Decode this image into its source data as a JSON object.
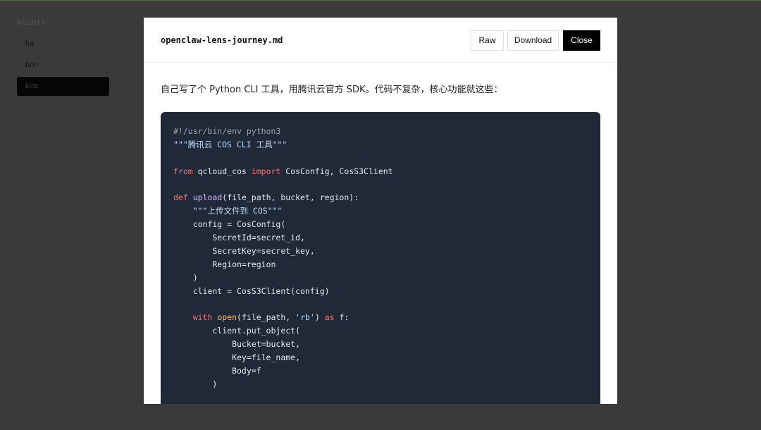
{
  "sidebar": {
    "heading": "AGENTS",
    "items": [
      {
        "label": "ha",
        "active": false
      },
      {
        "label": "hon",
        "active": false
      },
      {
        "label": "kira",
        "active": true
      }
    ]
  },
  "modal": {
    "file_name": "openclaw-lens-journey.md",
    "buttons": {
      "raw": "Raw",
      "download": "Download",
      "close": "Close"
    },
    "intro": "自己写了个 Python CLI 工具，用腾讯云官方 SDK。代码不复杂，核心功能就这些：",
    "code_lines": [
      [
        [
          "comment",
          "#!/usr/bin/env python3"
        ]
      ],
      [
        [
          "string",
          "\"\"\"腾讯云 COS CLI 工具\"\"\""
        ]
      ],
      [],
      [
        [
          "keyword",
          "from"
        ],
        [
          "plain",
          " qcloud_cos "
        ],
        [
          "keyword",
          "import"
        ],
        [
          "plain",
          " CosConfig, CosS3Client"
        ]
      ],
      [],
      [
        [
          "def",
          "def"
        ],
        [
          "plain",
          " "
        ],
        [
          "func",
          "upload"
        ],
        [
          "plain",
          "(file_path, bucket, region):"
        ]
      ],
      [
        [
          "plain",
          "    "
        ],
        [
          "string",
          "\"\"\"上传文件到 COS\"\"\""
        ]
      ],
      [
        [
          "plain",
          "    config = CosConfig("
        ]
      ],
      [
        [
          "plain",
          "        SecretId=secret_id,"
        ]
      ],
      [
        [
          "plain",
          "        SecretKey=secret_key,"
        ]
      ],
      [
        [
          "plain",
          "        Region=region"
        ]
      ],
      [
        [
          "plain",
          "    )"
        ]
      ],
      [
        [
          "plain",
          "    client = CosS3Client(config)"
        ]
      ],
      [],
      [
        [
          "plain",
          "    "
        ],
        [
          "keyword",
          "with"
        ],
        [
          "plain",
          " "
        ],
        [
          "builtin",
          "open"
        ],
        [
          "plain",
          "(file_path, "
        ],
        [
          "string",
          "'rb'"
        ],
        [
          "plain",
          ") "
        ],
        [
          "keyword",
          "as"
        ],
        [
          "plain",
          " f:"
        ]
      ],
      [
        [
          "plain",
          "        client.put_object("
        ]
      ],
      [
        [
          "plain",
          "            Bucket=bucket,"
        ]
      ],
      [
        [
          "plain",
          "            Key=file_name,"
        ]
      ],
      [
        [
          "plain",
          "            Body=f"
        ]
      ],
      [
        [
          "plain",
          "        )"
        ]
      ]
    ]
  }
}
